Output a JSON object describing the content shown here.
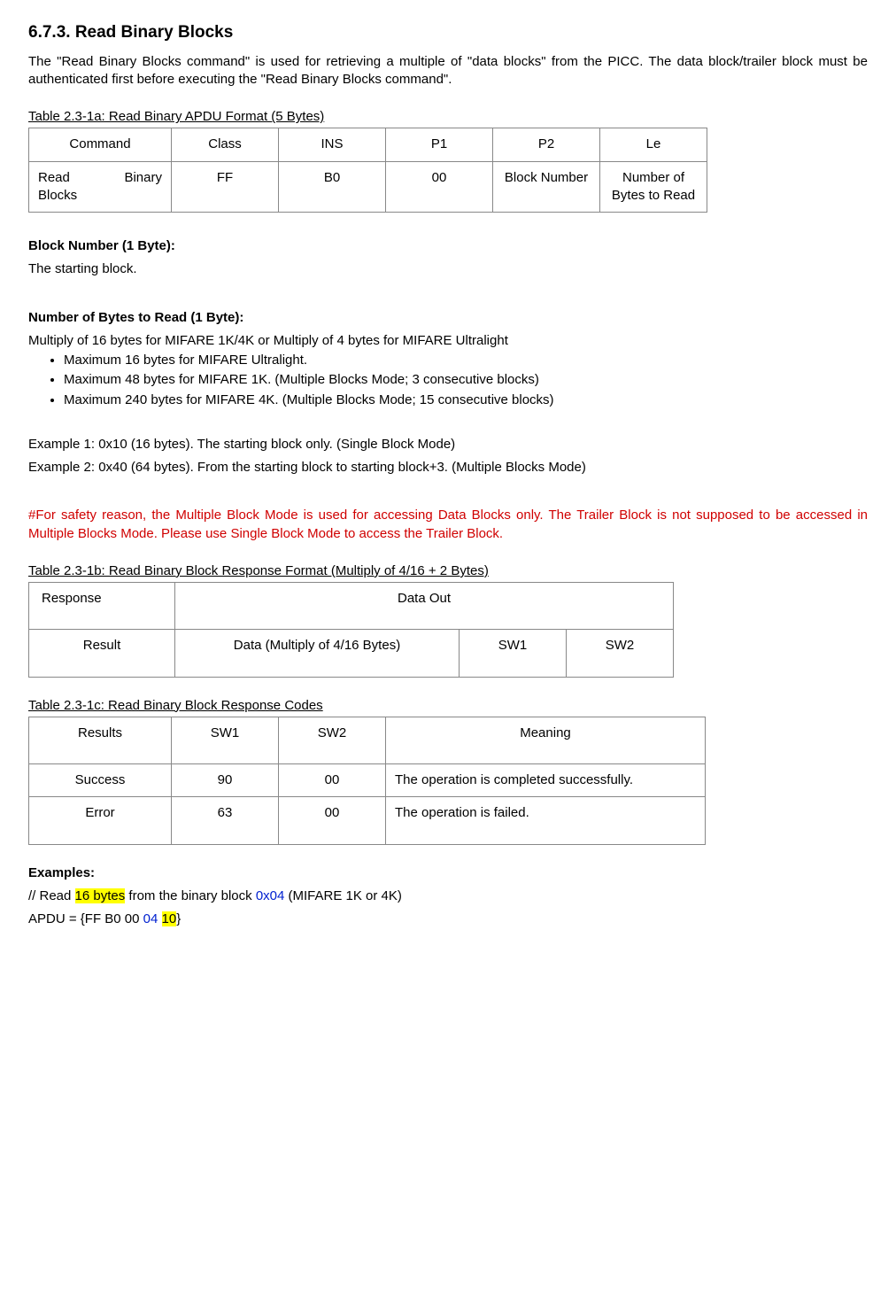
{
  "heading": "6.7.3.       Read Binary Blocks",
  "intro": "The \"Read Binary Blocks command\" is used for retrieving a multiple of \"data blocks\" from the PICC. The data block/trailer block must be authenticated first before executing the \"Read Binary Blocks command\".",
  "table1": {
    "caption": "Table 2.3-1a: Read Binary APDU Format (5 Bytes)",
    "headers": {
      "c0": "Command",
      "c1": "Class",
      "c2": "INS",
      "c3": "P1",
      "c4": "P2",
      "c5": "Le"
    },
    "row": {
      "c0a": "Read",
      "c0b": "Binary",
      "c0c": "Blocks",
      "c1": "FF",
      "c2": "B0",
      "c3": "00",
      "c4": "Block Number",
      "c5": "Number of Bytes to Read"
    }
  },
  "blocknum": {
    "title": "Block Number (1 Byte):",
    "text": "The starting block."
  },
  "numbytes": {
    "title": "Number of Bytes to Read (1 Byte):",
    "lead": "Multiply of 16 bytes for MIFARE 1K/4K or Multiply of 4 bytes for MIFARE Ultralight",
    "li1": "Maximum 16 bytes for MIFARE Ultralight.",
    "li2": "Maximum 48 bytes for MIFARE 1K. (Multiple Blocks Mode; 3 consecutive blocks)",
    "li3": "Maximum 240 bytes for MIFARE 4K. (Multiple Blocks Mode; 15 consecutive blocks)"
  },
  "ex1": "Example 1: 0x10 (16 bytes). The starting block only. (Single Block Mode)",
  "ex2": "Example 2: 0x40 (64 bytes). From the starting block to starting block+3. (Multiple Blocks Mode)",
  "warn": "#For safety reason, the Multiple Block Mode is used for accessing Data Blocks only. The Trailer Block is not supposed to be accessed in Multiple Blocks Mode. Please use Single Block Mode to access the Trailer Block.",
  "table2": {
    "caption": "Table 2.3-1b: Read Binary Block Response Format (Multiply of 4/16 + 2 Bytes)",
    "h0": "Response",
    "h1": "Data Out",
    "r0": "Result",
    "r1": "Data (Multiply of 4/16 Bytes)",
    "r2": "SW1",
    "r3": "SW2"
  },
  "table3": {
    "caption": "Table 2.3-1c: Read Binary Block Response Codes",
    "h0": "Results",
    "h1": "SW1",
    "h2": "SW2",
    "h3": "Meaning",
    "row1": {
      "c0": "Success",
      "c1": "90",
      "c2": "00",
      "c3": "The operation is completed successfully."
    },
    "row2": {
      "c0": "Error",
      "c1": "63",
      "c2": "00",
      "c3": "The operation is failed."
    }
  },
  "examples": {
    "title": "Examples:",
    "line1a": "// Read ",
    "line1b": "16 bytes",
    "line1c": " from the binary block ",
    "line1d": "0x04",
    "line1e": " (MIFARE 1K or 4K)",
    "line2a": "APDU = {FF B0 00 ",
    "line2b": "04",
    "line2c": " ",
    "line2d": "10",
    "line2e": "}"
  }
}
